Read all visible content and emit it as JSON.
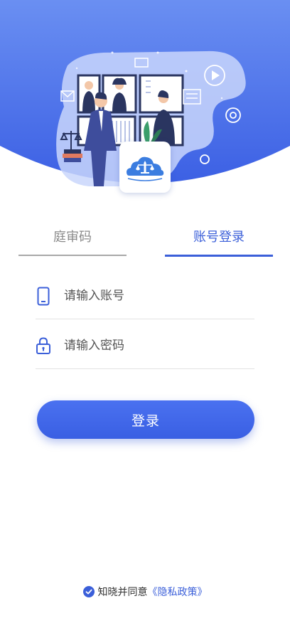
{
  "tabs": {
    "court_code": "庭审码",
    "account_login": "账号登录",
    "active": "account_login"
  },
  "form": {
    "account_placeholder": "请输入账号",
    "account_value": "",
    "password_placeholder": "请输入密码",
    "password_value": ""
  },
  "login_button": "登录",
  "agreement": {
    "prefix": "知晓并同意",
    "policy_link": "《隐私政策》",
    "checked": true
  },
  "colors": {
    "brand_blue": "#3b5fd9",
    "hero_gradient_top": "#6a90f2",
    "hero_gradient_bottom": "#3d62e6"
  },
  "icons": {
    "account": "phone-icon",
    "password": "lock-icon",
    "agree": "check-circle-icon",
    "logo": "court-logo-icon"
  }
}
